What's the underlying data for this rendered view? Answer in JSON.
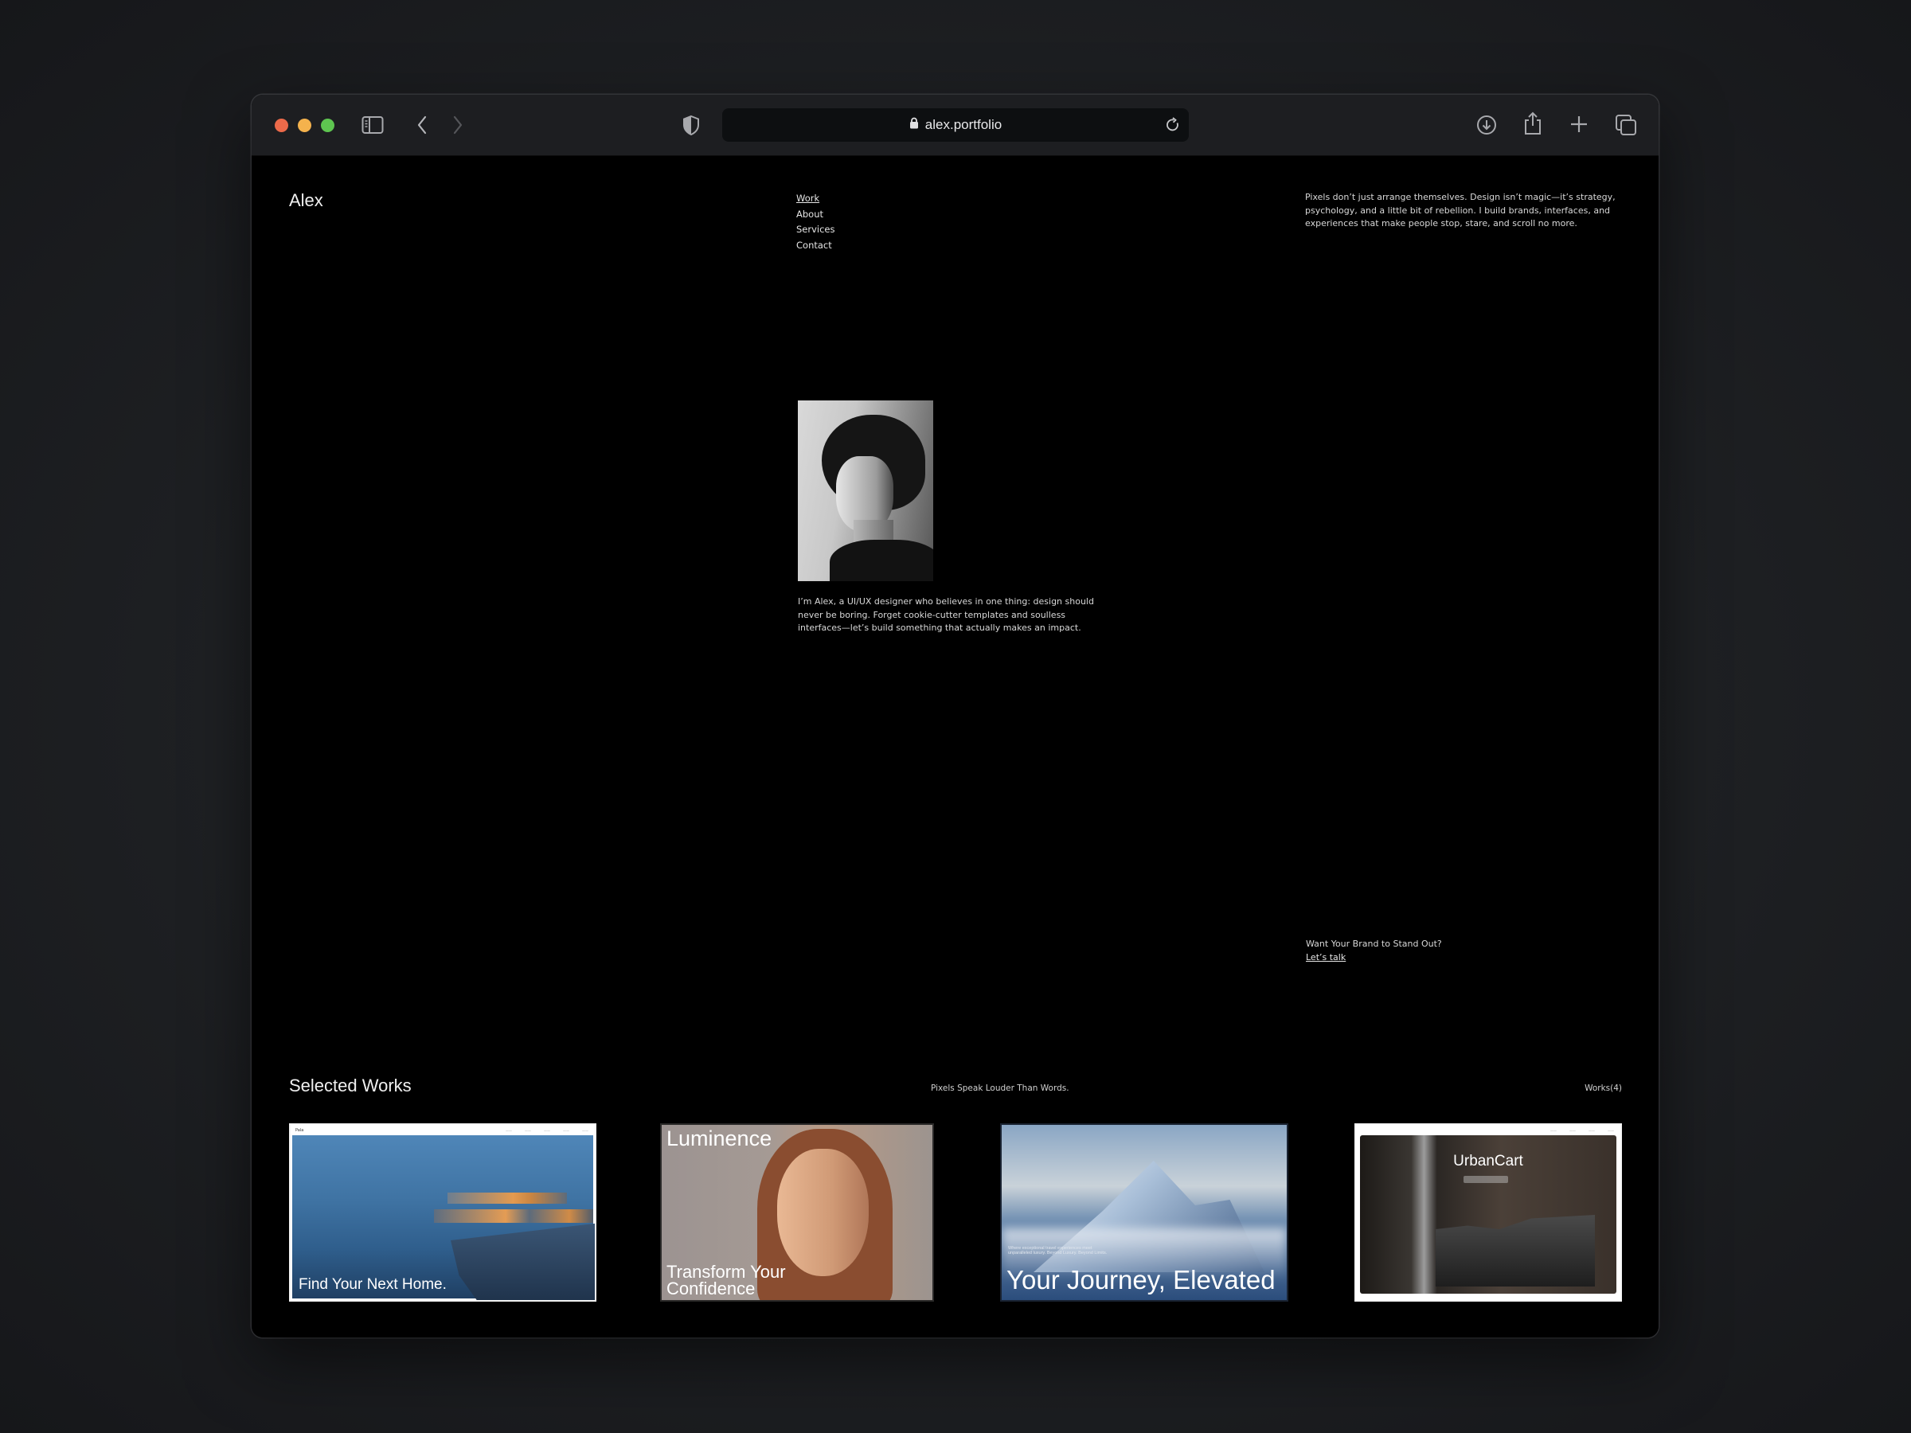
{
  "browser": {
    "url": "alex.portfolio",
    "icons": {
      "sidebar": "sidebar-icon",
      "back": "chevron-left-icon",
      "forward": "chevron-right-icon",
      "privacy": "shield-icon",
      "lock": "lock-icon",
      "reload": "reload-icon",
      "downloads": "download-icon",
      "share": "share-icon",
      "new_tab": "plus-icon",
      "tabs": "tabs-overview-icon"
    }
  },
  "header": {
    "brand": "Alex",
    "nav": [
      {
        "label": "Work",
        "active": true
      },
      {
        "label": "About",
        "active": false
      },
      {
        "label": "Services",
        "active": false
      },
      {
        "label": "Contact",
        "active": false
      }
    ],
    "intro": "Pixels don’t just arrange themselves. Design isn’t magic—it’s strategy, psychology, and a little bit of rebellion. I build brands, interfaces, and experiences that make people stop, stare, and scroll no more."
  },
  "hero": {
    "portrait_alt": "Black and white portrait of Alex",
    "bio": "I’m Alex, a UI/UX designer who believes in one thing: design should never be boring. Forget cookie-cutter templates and soulless interfaces—let’s build something that actually makes an impact."
  },
  "cta": {
    "question": "Want Your Brand to Stand Out?",
    "link": "Let’s talk"
  },
  "works": {
    "title": "Selected Works",
    "tagline": "Pixels Speak Louder Than Words.",
    "count_label": "Works(4)",
    "items": [
      {
        "brand": "Pala",
        "headline": "Find Your Next Home."
      },
      {
        "brand": "Luminence",
        "headline_line1": "Transform Your",
        "headline_line2": "Confidence"
      },
      {
        "small": "Where exceptional travel experiences meet unparalleled luxury. Beyond Luxury. Beyond Limits.",
        "headline": "Your Journey, Elevated"
      },
      {
        "brand": "UrbanCart",
        "headline": "UrbanCart"
      }
    ]
  },
  "colors": {
    "window_bg": "#000000",
    "toolbar_bg": "#1d1e21",
    "close": "#ec6a4a",
    "minimize": "#f4b24d",
    "zoom": "#5ec550"
  }
}
